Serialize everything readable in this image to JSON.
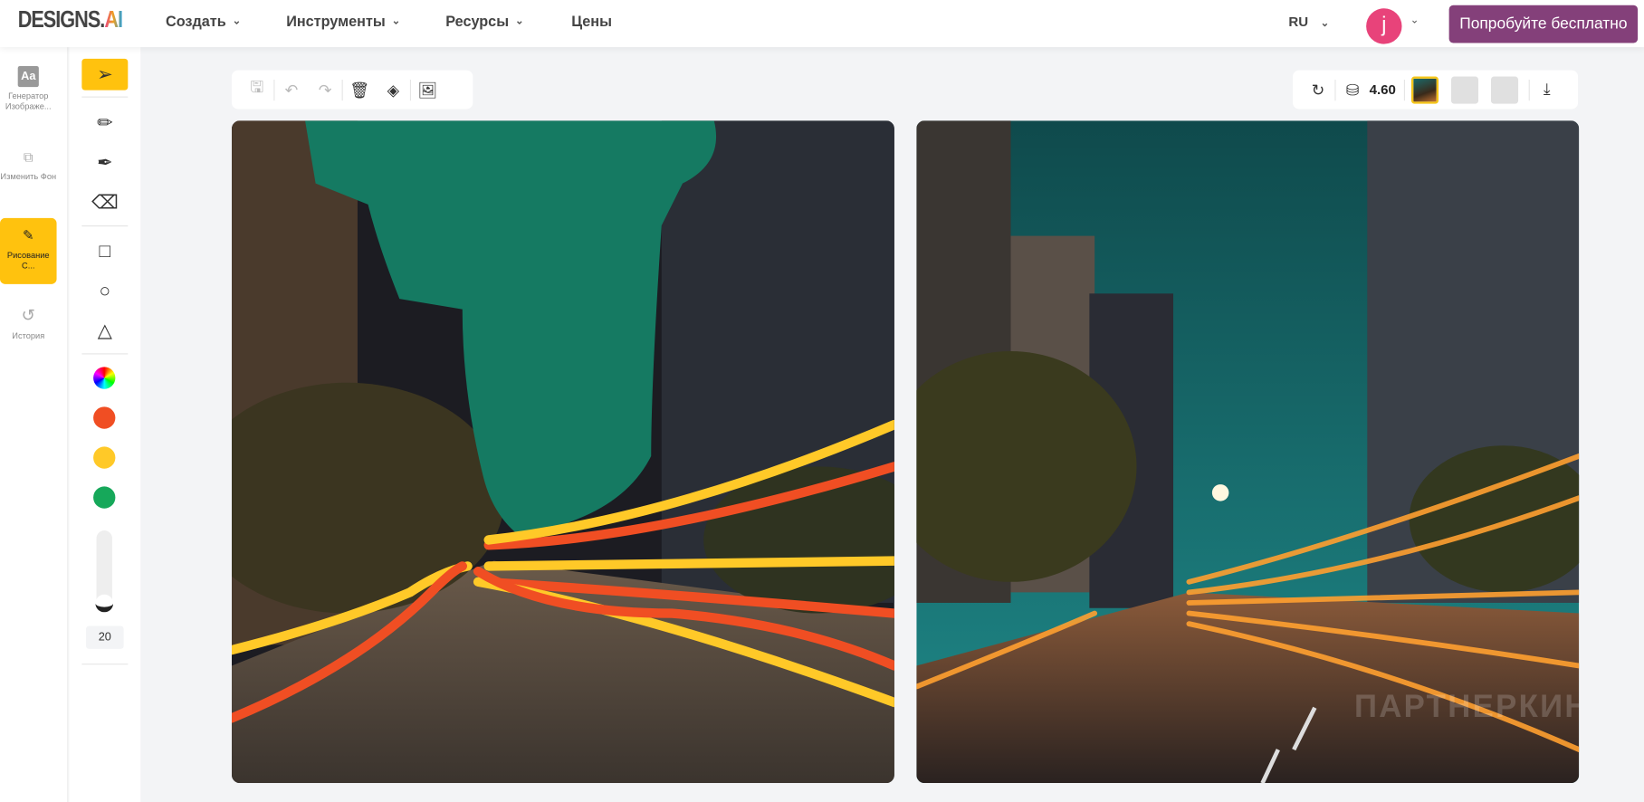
{
  "header": {
    "logo": "DESIGNS.AI",
    "nav": [
      "Создать",
      "Инструменты",
      "Ресурсы",
      "Цены"
    ],
    "language": "RU",
    "avatar_letter": "j",
    "cta": "Попробуйте бесплатно"
  },
  "sidebar": {
    "items": [
      {
        "label": "Генератор Изображе...",
        "icon": "text-aa-icon"
      },
      {
        "label": "Изменить Фон",
        "icon": "swap-background-icon"
      },
      {
        "label": "Рисование С...",
        "icon": "draw-icon",
        "active": true
      },
      {
        "label": "История",
        "icon": "history-icon"
      }
    ]
  },
  "tools": {
    "items": [
      "select",
      "pencil",
      "highlighter",
      "eraser",
      "rectangle",
      "circle",
      "triangle"
    ],
    "colors": [
      "#f04e23",
      "#ffc928",
      "#16a85a"
    ],
    "brush_size": "20",
    "brush_level": 0.05
  },
  "canvas_toolbar": {
    "items": [
      "save",
      "undo",
      "redo",
      "delete",
      "fill",
      "image"
    ]
  },
  "result_toolbar": {
    "credits": "4.60"
  },
  "watermark": "ПАРТНЕРКИН",
  "colors": {
    "accent": "#ffc20e",
    "cta": "#84407a"
  }
}
